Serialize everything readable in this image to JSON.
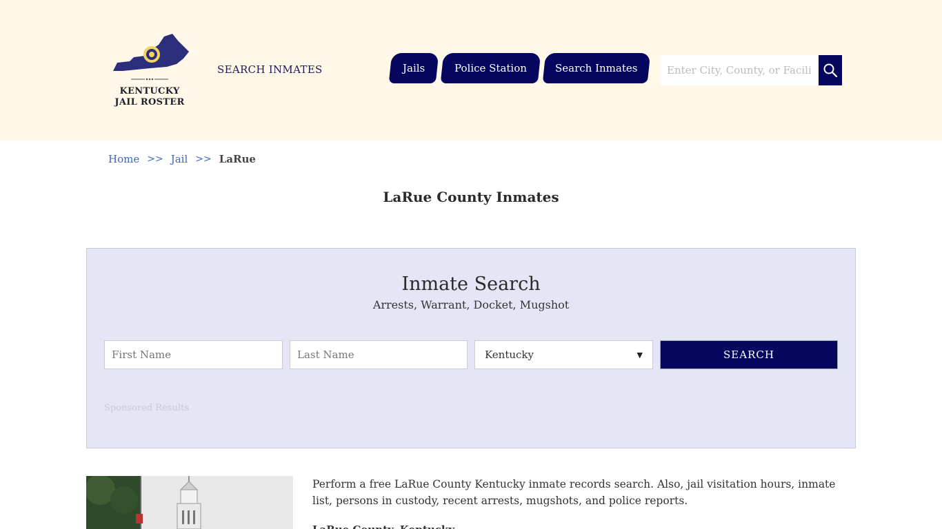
{
  "header": {
    "logo_line1": "KENTUCKY",
    "logo_line2": "JAIL ROSTER",
    "search_inmates_link": "SEARCH INMATES",
    "nav": [
      {
        "label": "Jails"
      },
      {
        "label": "Police Station"
      },
      {
        "label": "Search Inmates"
      }
    ],
    "search_placeholder": "Enter City, County, or Facility",
    "colors": {
      "background": "#fff8e8",
      "accent": "#06065e"
    }
  },
  "breadcrumb": {
    "home": "Home",
    "sep1": ">>",
    "jail": "Jail",
    "sep2": ">>",
    "current": "LaRue"
  },
  "page_title": "LaRue County Inmates",
  "search_panel": {
    "title": "Inmate Search",
    "subtitle": "Arrests, Warrant, Docket, Mugshot",
    "first_name_placeholder": "First Name",
    "last_name_placeholder": "Last Name",
    "state_selected": "Kentucky",
    "search_button": "SEARCH",
    "sponsored_label": "Sponsored Results"
  },
  "content": {
    "intro": "Perform a free LaRue County Kentucky inmate records search. Also, jail visitation hours, inmate list, persons in custody, recent arrests, mugshots, and police reports.",
    "subheading": "LaRue County, Kentucky"
  }
}
